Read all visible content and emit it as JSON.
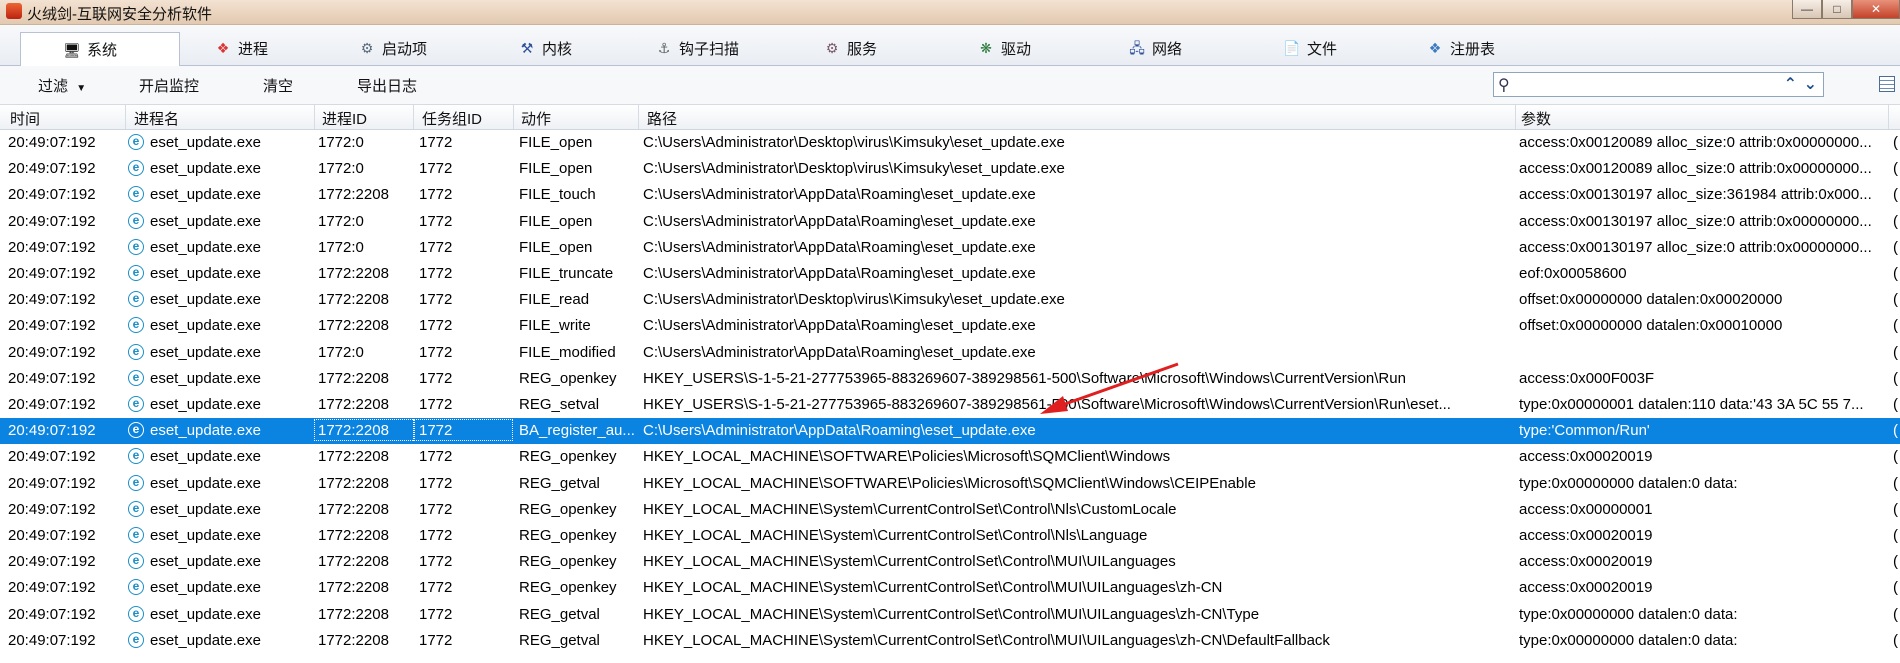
{
  "window": {
    "title": "火绒剑-互联网安全分析软件"
  },
  "tabs": [
    {
      "label": "系统",
      "icon": "monitor-icon"
    },
    {
      "label": "进程",
      "icon": "windows-flag-icon"
    },
    {
      "label": "启动项",
      "icon": "startup-gear-icon"
    },
    {
      "label": "内核",
      "icon": "hammer-icon"
    },
    {
      "label": "钩子扫描",
      "icon": "hook-icon"
    },
    {
      "label": "服务",
      "icon": "service-gear-icon"
    },
    {
      "label": "驱动",
      "icon": "driver-icon"
    },
    {
      "label": "网络",
      "icon": "network-icon"
    },
    {
      "label": "文件",
      "icon": "file-icon"
    },
    {
      "label": "注册表",
      "icon": "registry-icon"
    }
  ],
  "toolbar": {
    "filter": "过滤",
    "monitor": "开启监控",
    "clear": "清空",
    "export": "导出日志"
  },
  "search": {
    "value": ""
  },
  "columns": {
    "time": "时间",
    "process": "进程名",
    "pid": "进程ID",
    "taskgroup": "任务组ID",
    "action": "动作",
    "path": "路径",
    "params": "参数"
  },
  "rows": [
    {
      "time": "20:49:07:192",
      "proc": "eset_update.exe",
      "pid": "1772:0",
      "tid": "1772",
      "action": "FILE_open",
      "path": "C:\\Users\\Administrator\\Desktop\\virus\\Kimsuky\\eset_update.exe",
      "param": "access:0x00120089 alloc_size:0 attrib:0x00000000...",
      "edge": "("
    },
    {
      "time": "20:49:07:192",
      "proc": "eset_update.exe",
      "pid": "1772:0",
      "tid": "1772",
      "action": "FILE_open",
      "path": "C:\\Users\\Administrator\\Desktop\\virus\\Kimsuky\\eset_update.exe",
      "param": "access:0x00120089 alloc_size:0 attrib:0x00000000...",
      "edge": "("
    },
    {
      "time": "20:49:07:192",
      "proc": "eset_update.exe",
      "pid": "1772:2208",
      "tid": "1772",
      "action": "FILE_touch",
      "path": "C:\\Users\\Administrator\\AppData\\Roaming\\eset_update.exe",
      "param": "access:0x00130197 alloc_size:361984 attrib:0x000...",
      "edge": "("
    },
    {
      "time": "20:49:07:192",
      "proc": "eset_update.exe",
      "pid": "1772:0",
      "tid": "1772",
      "action": "FILE_open",
      "path": "C:\\Users\\Administrator\\AppData\\Roaming\\eset_update.exe",
      "param": "access:0x00130197 alloc_size:0 attrib:0x00000000...",
      "edge": "("
    },
    {
      "time": "20:49:07:192",
      "proc": "eset_update.exe",
      "pid": "1772:0",
      "tid": "1772",
      "action": "FILE_open",
      "path": "C:\\Users\\Administrator\\AppData\\Roaming\\eset_update.exe",
      "param": "access:0x00130197 alloc_size:0 attrib:0x00000000...",
      "edge": "("
    },
    {
      "time": "20:49:07:192",
      "proc": "eset_update.exe",
      "pid": "1772:2208",
      "tid": "1772",
      "action": "FILE_truncate",
      "path": "C:\\Users\\Administrator\\AppData\\Roaming\\eset_update.exe",
      "param": "eof:0x00058600",
      "edge": "("
    },
    {
      "time": "20:49:07:192",
      "proc": "eset_update.exe",
      "pid": "1772:2208",
      "tid": "1772",
      "action": "FILE_read",
      "path": "C:\\Users\\Administrator\\Desktop\\virus\\Kimsuky\\eset_update.exe",
      "param": "offset:0x00000000 datalen:0x00020000",
      "edge": "("
    },
    {
      "time": "20:49:07:192",
      "proc": "eset_update.exe",
      "pid": "1772:2208",
      "tid": "1772",
      "action": "FILE_write",
      "path": "C:\\Users\\Administrator\\AppData\\Roaming\\eset_update.exe",
      "param": "offset:0x00000000 datalen:0x00010000",
      "edge": "("
    },
    {
      "time": "20:49:07:192",
      "proc": "eset_update.exe",
      "pid": "1772:0",
      "tid": "1772",
      "action": "FILE_modified",
      "path": "C:\\Users\\Administrator\\AppData\\Roaming\\eset_update.exe",
      "param": "",
      "edge": "("
    },
    {
      "time": "20:49:07:192",
      "proc": "eset_update.exe",
      "pid": "1772:2208",
      "tid": "1772",
      "action": "REG_openkey",
      "path": "HKEY_USERS\\S-1-5-21-277753965-883269607-389298561-500\\Software\\Microsoft\\Windows\\CurrentVersion\\Run",
      "param": "access:0x000F003F",
      "edge": "("
    },
    {
      "time": "20:49:07:192",
      "proc": "eset_update.exe",
      "pid": "1772:2208",
      "tid": "1772",
      "action": "REG_setval",
      "path": "HKEY_USERS\\S-1-5-21-277753965-883269607-389298561-500\\Software\\Microsoft\\Windows\\CurrentVersion\\Run\\eset...",
      "param": "type:0x00000001 datalen:110 data:'43 3A 5C 55 7...",
      "edge": "("
    },
    {
      "time": "20:49:07:192",
      "proc": "eset_update.exe",
      "pid": "1772:2208",
      "tid": "1772",
      "action": "BA_register_au...",
      "path": "C:\\Users\\Administrator\\AppData\\Roaming\\eset_update.exe",
      "param": "type:'Common/Run'",
      "edge": "(",
      "selected": true
    },
    {
      "time": "20:49:07:192",
      "proc": "eset_update.exe",
      "pid": "1772:2208",
      "tid": "1772",
      "action": "REG_openkey",
      "path": "HKEY_LOCAL_MACHINE\\SOFTWARE\\Policies\\Microsoft\\SQMClient\\Windows",
      "param": "access:0x00020019",
      "edge": "("
    },
    {
      "time": "20:49:07:192",
      "proc": "eset_update.exe",
      "pid": "1772:2208",
      "tid": "1772",
      "action": "REG_getval",
      "path": "HKEY_LOCAL_MACHINE\\SOFTWARE\\Policies\\Microsoft\\SQMClient\\Windows\\CEIPEnable",
      "param": "type:0x00000000 datalen:0 data:",
      "edge": "("
    },
    {
      "time": "20:49:07:192",
      "proc": "eset_update.exe",
      "pid": "1772:2208",
      "tid": "1772",
      "action": "REG_openkey",
      "path": "HKEY_LOCAL_MACHINE\\System\\CurrentControlSet\\Control\\Nls\\CustomLocale",
      "param": "access:0x00000001",
      "edge": "("
    },
    {
      "time": "20:49:07:192",
      "proc": "eset_update.exe",
      "pid": "1772:2208",
      "tid": "1772",
      "action": "REG_openkey",
      "path": "HKEY_LOCAL_MACHINE\\System\\CurrentControlSet\\Control\\Nls\\Language",
      "param": "access:0x00020019",
      "edge": "("
    },
    {
      "time": "20:49:07:192",
      "proc": "eset_update.exe",
      "pid": "1772:2208",
      "tid": "1772",
      "action": "REG_openkey",
      "path": "HKEY_LOCAL_MACHINE\\System\\CurrentControlSet\\Control\\MUI\\UILanguages",
      "param": "access:0x00020019",
      "edge": "("
    },
    {
      "time": "20:49:07:192",
      "proc": "eset_update.exe",
      "pid": "1772:2208",
      "tid": "1772",
      "action": "REG_openkey",
      "path": "HKEY_LOCAL_MACHINE\\System\\CurrentControlSet\\Control\\MUI\\UILanguages\\zh-CN",
      "param": "access:0x00020019",
      "edge": "("
    },
    {
      "time": "20:49:07:192",
      "proc": "eset_update.exe",
      "pid": "1772:2208",
      "tid": "1772",
      "action": "REG_getval",
      "path": "HKEY_LOCAL_MACHINE\\System\\CurrentControlSet\\Control\\MUI\\UILanguages\\zh-CN\\Type",
      "param": "type:0x00000000 datalen:0 data:",
      "edge": "("
    },
    {
      "time": "20:49:07:192",
      "proc": "eset_update.exe",
      "pid": "1772:2208",
      "tid": "1772",
      "action": "REG_getval",
      "path": "HKEY_LOCAL_MACHINE\\System\\CurrentControlSet\\Control\\MUI\\UILanguages\\zh-CN\\DefaultFallback",
      "param": "type:0x00000000 datalen:0 data:",
      "edge": "("
    }
  ],
  "colors": {
    "selected_row": "#0a84e0",
    "arrow": "#e02020",
    "process_icon": "#1b8fc7"
  }
}
